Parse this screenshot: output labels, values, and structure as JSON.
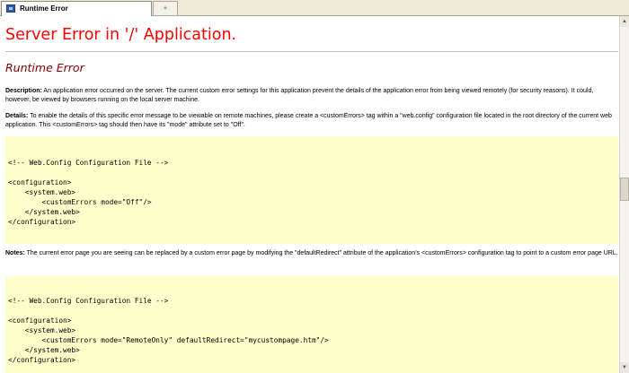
{
  "tabs": {
    "active_label": "Runtime Error",
    "new_tab_symbol": "+"
  },
  "page": {
    "server_error_title": "Server Error in '/' Application.",
    "runtime_error_title": "Runtime Error",
    "description_label": "Description:",
    "description_text": " An application error occurred on the server. The current custom error settings for this application prevent the details of the application error from being viewed remotely (for security reasons). It could, however, be viewed by browsers running on the local server machine.",
    "details_label": "Details:",
    "details_text": " To enable the details of this specific error message to be viewable on remote machines, please create a <customErrors> tag within a \"web.config\" configuration file located in the root directory of the current web application. This <customErrors> tag should then have its \"mode\" attribute set to \"Off\".",
    "code_block_1": "<!-- Web.Config Configuration File -->\n\n<configuration>\n    <system.web>\n        <customErrors mode=\"Off\"/>\n    </system.web>\n</configuration>",
    "notes_label": "Notes:",
    "notes_text": " The current error page you are seeing can be replaced by a custom error page by modifying the \"defaultRedirect\" attribute of the application's <customErrors> configuration tag to point to a custom error page URL.",
    "code_block_2": "<!-- Web.Config Configuration File -->\n\n<configuration>\n    <system.web>\n        <customErrors mode=\"RemoteOnly\" defaultRedirect=\"mycustompage.htm\"/>\n    </system.web>\n</configuration>"
  },
  "colors": {
    "title_red": "#ff0000",
    "subtitle_maroon": "#800000",
    "code_background": "#ffffcc"
  },
  "icons": {
    "tab_icon": "browser-page-icon",
    "scroll_up": "arrow-up-icon",
    "scroll_down": "arrow-down-icon"
  }
}
